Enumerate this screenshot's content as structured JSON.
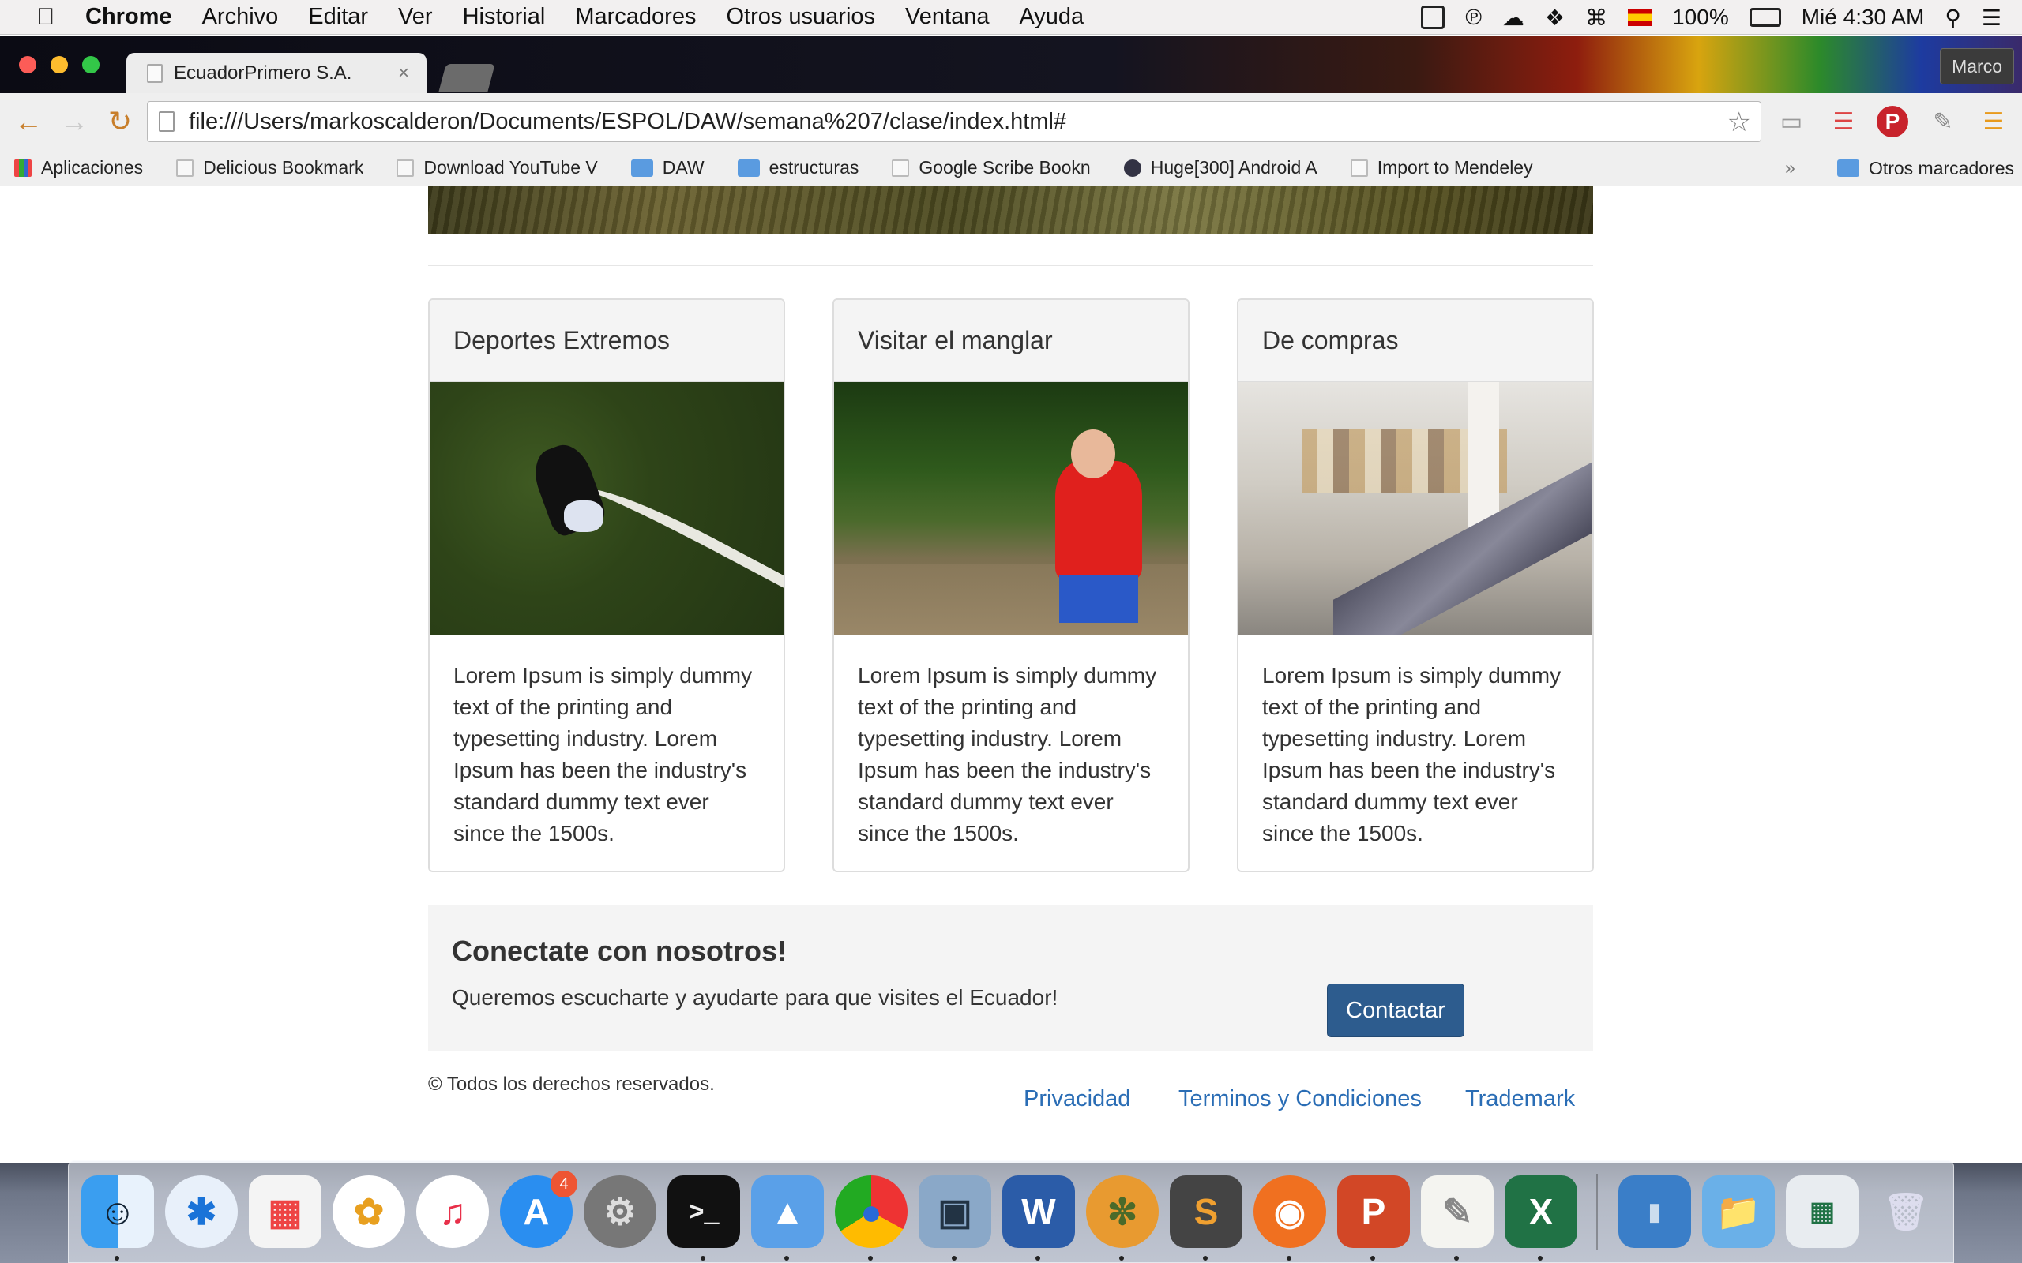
{
  "menubar": {
    "items": [
      "Chrome",
      "Archivo",
      "Editar",
      "Ver",
      "Historial",
      "Marcadores",
      "Otros usuarios",
      "Ventana",
      "Ayuda"
    ],
    "battery": "100%",
    "clock": "Mié 4:30 AM"
  },
  "browser": {
    "tab_title": "EcuadorPrimero S.A.",
    "profile_name": "Marco",
    "url": "file:///Users/markoscalderon/Documents/ESPOL/DAW/semana%207/clase/index.html#",
    "bookmarks": [
      {
        "label": "Aplicaciones",
        "icon": "apps-icon"
      },
      {
        "label": "Delicious Bookmark",
        "icon": "page-icon"
      },
      {
        "label": "Download YouTube V",
        "icon": "page-icon"
      },
      {
        "label": "DAW",
        "icon": "folder-icon"
      },
      {
        "label": "estructuras",
        "icon": "folder-icon"
      },
      {
        "label": "Google Scribe Bookn",
        "icon": "page-icon"
      },
      {
        "label": "Huge[300] Android A",
        "icon": "huge-icon"
      },
      {
        "label": "Import to Mendeley",
        "icon": "page-icon"
      }
    ],
    "bookmarks_more": "»",
    "other_bookmarks": "Otros marcadores"
  },
  "page": {
    "cards": [
      {
        "title": "Deportes Extremos",
        "text": "Lorem Ipsum is simply dummy text of the printing and typesetting industry. Lorem Ipsum has been the industry's standard dummy text ever since the 1500s."
      },
      {
        "title": "Visitar el manglar",
        "text": "Lorem Ipsum is simply dummy text of the printing and typesetting industry. Lorem Ipsum has been the industry's standard dummy text ever since the 1500s."
      },
      {
        "title": "De compras",
        "text": "Lorem Ipsum is simply dummy text of the printing and typesetting industry. Lorem Ipsum has been the industry's standard dummy text ever since the 1500s."
      }
    ],
    "connect": {
      "title": "Conectate con nosotros!",
      "text": "Queremos escucharte y ayudarte para que visites el Ecuador!",
      "button": "Contactar"
    },
    "footer": {
      "copyright": "© Todos los derechos reservados.",
      "links": [
        "Privacidad",
        "Terminos y Condiciones",
        "Trademark"
      ]
    }
  },
  "dock": {
    "app_store_badge": "4"
  },
  "colors": {
    "primary_button": "#2d5c8e",
    "link": "#2a6db5",
    "card_header_bg": "#f4f4f4"
  }
}
